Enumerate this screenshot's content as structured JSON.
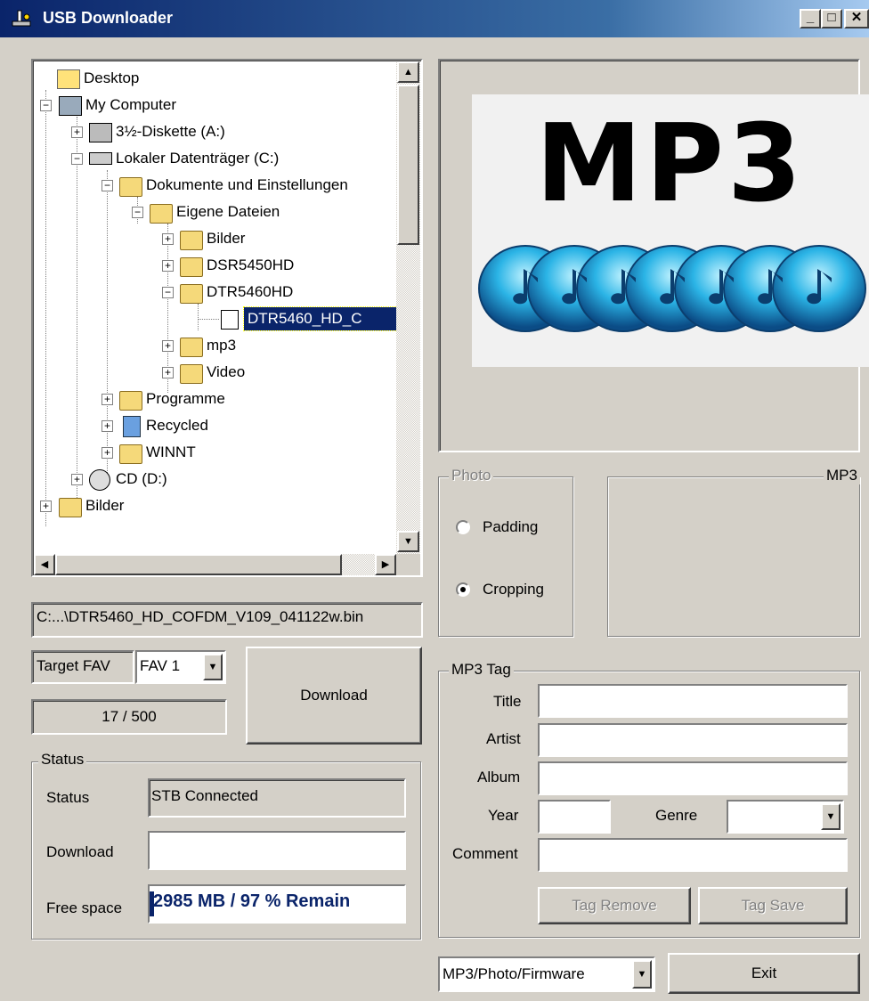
{
  "window": {
    "title": "USB Downloader",
    "min": "_",
    "max": "□",
    "close": "✕"
  },
  "tree": {
    "items": [
      {
        "label": "Desktop"
      },
      {
        "label": "My Computer"
      },
      {
        "label": "3½-Diskette (A:)"
      },
      {
        "label": "Lokaler Datenträger (C:)"
      },
      {
        "label": "Dokumente und Einstellungen"
      },
      {
        "label": "Eigene Dateien"
      },
      {
        "label": "Bilder"
      },
      {
        "label": "DSR5450HD"
      },
      {
        "label": "DTR5460HD"
      },
      {
        "label": "DTR5460_HD_C"
      },
      {
        "label": "mp3"
      },
      {
        "label": "Video"
      },
      {
        "label": "Programme"
      },
      {
        "label": "Recycled"
      },
      {
        "label": "WINNT"
      },
      {
        "label": "CD (D:)"
      },
      {
        "label": "Bilder"
      }
    ]
  },
  "path": "C:...\\DTR5460_HD_COFDM_V109_041122w.bin",
  "target": {
    "label": "Target FAV",
    "value": "FAV 1"
  },
  "counter": "17 / 500",
  "download_button": "Download",
  "status": {
    "legend": "Status",
    "status_label": "Status",
    "status_value": "STB Connected",
    "download_label": "Download",
    "download_value": "",
    "free_label": "Free space",
    "free_value": "2985 MB / 97 % Remain"
  },
  "preview": {
    "logo_text": "MP3"
  },
  "photo": {
    "legend": "Photo",
    "padding": "Padding",
    "cropping": "Cropping",
    "selected": "Cropping"
  },
  "mp3_group": {
    "legend": "MP3"
  },
  "mp3tag": {
    "legend": "MP3 Tag",
    "title": "Title",
    "artist": "Artist",
    "album": "Album",
    "year": "Year",
    "genre": "Genre",
    "comment": "Comment",
    "remove": "Tag Remove",
    "save": "Tag Save"
  },
  "mode": {
    "value": "MP3/Photo/Firmware"
  },
  "exit": "Exit"
}
